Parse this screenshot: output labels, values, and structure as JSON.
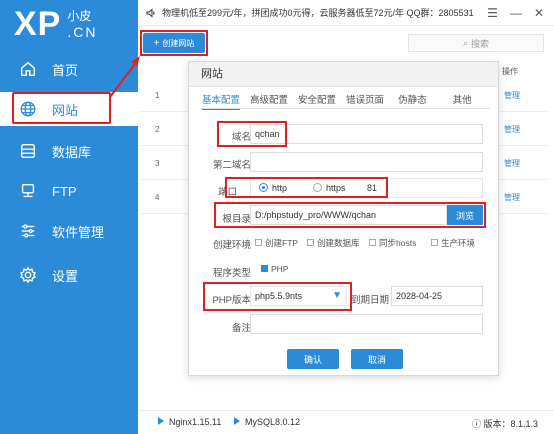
{
  "logo": {
    "main": "XP",
    "cn_top": "小皮",
    "cn_bottom": ".CN"
  },
  "sidebar": {
    "items": [
      {
        "label": "首页",
        "icon": "home-icon"
      },
      {
        "label": "网站",
        "icon": "globe-icon"
      },
      {
        "label": "数据库",
        "icon": "database-icon"
      },
      {
        "label": "FTP",
        "icon": "ftp-icon"
      },
      {
        "label": "软件管理",
        "icon": "sliders-icon"
      },
      {
        "label": "设置",
        "icon": "gear-icon"
      }
    ]
  },
  "topbar": {
    "notice": "物理机低至299元/年，拼团成功0元得，云服务器低至72元/年 QQ群：2805531"
  },
  "toolbar": {
    "create_label": "创建网站",
    "search_placeholder": "搜索"
  },
  "table": {
    "op_header": "操作",
    "rows": [
      "1",
      "2",
      "3",
      "4"
    ],
    "manage_label": "管理"
  },
  "dialog": {
    "title": "网站",
    "tabs": [
      "基本配置",
      "高级配置",
      "安全配置",
      "错误页面",
      "伪静态",
      "其他"
    ],
    "domain_label": "域名",
    "domain_value": "qchan",
    "second_domain_label": "第二域名",
    "second_domain_value": "",
    "port_label": "端口",
    "http_label": "http",
    "https_label": "https",
    "port_value": "81",
    "root_label": "根目录",
    "root_value": "D:/phpstudy_pro/WWW/qchan",
    "browse_label": "浏览",
    "env_label": "创建环境",
    "env_options": [
      "创建FTP",
      "创建数据库",
      "同步hosts",
      "生产环境"
    ],
    "program_type_label": "程序类型",
    "program_type_value": "PHP",
    "php_label": "PHP版本",
    "php_value": "php5.5.9nts",
    "expire_label": "到期日期",
    "expire_value": "2028-04-25",
    "remark_label": "备注",
    "remark_value": "",
    "confirm_label": "确认",
    "cancel_label": "取消"
  },
  "status": {
    "nginx": "Nginx1.15.11",
    "mysql": "MySQL8.0.12",
    "version": "版本：8.1.1.3"
  },
  "colors": {
    "primary": "#2b8bd8",
    "highlight": "#e02020"
  }
}
